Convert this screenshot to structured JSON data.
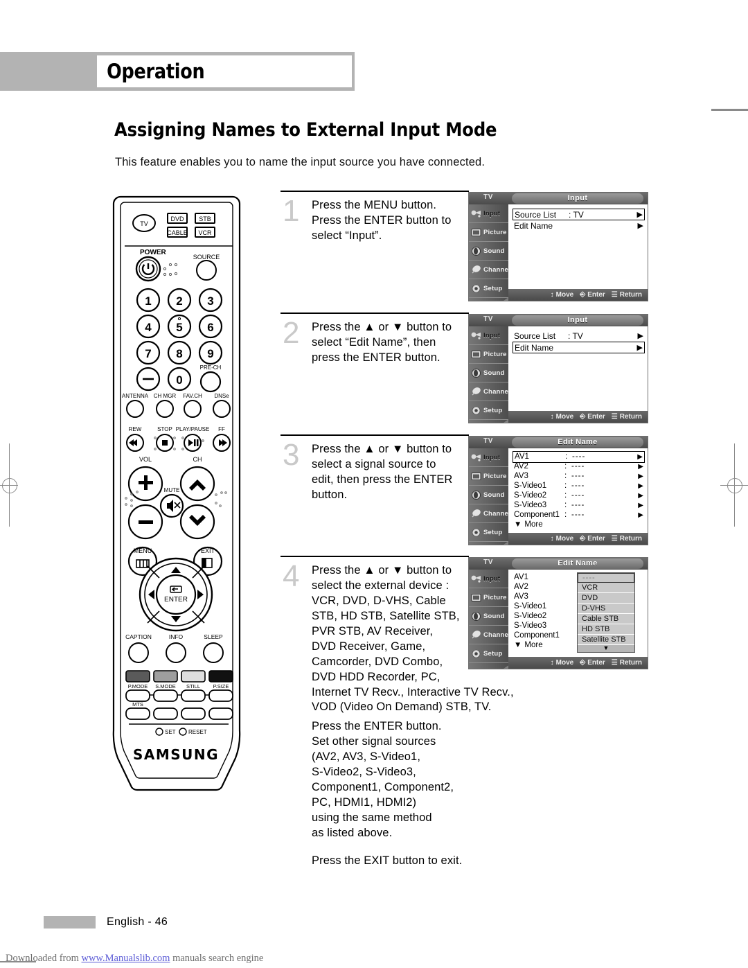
{
  "header": {
    "section_label": "Operation"
  },
  "page": {
    "title": "Assigning Names to External Input Mode",
    "intro": "This feature enables you to name the input source you have connected.",
    "footer_page": "English - 46",
    "download_prefix": "Downloaded from ",
    "download_link": "www.Manualslib.com",
    "download_suffix": " manuals search engine"
  },
  "steps": [
    {
      "num": "1",
      "lines": [
        "Press the MENU button.",
        "Press the ENTER button to",
        "select “Input”."
      ]
    },
    {
      "num": "2",
      "lines": [
        "Press the ▲ or ▼ button to",
        "select “Edit Name”, then",
        "press the ENTER button."
      ]
    },
    {
      "num": "3",
      "lines": [
        "Press the ▲ or ▼ button to",
        "select a signal source to",
        "edit, then press the ENTER",
        "button."
      ]
    },
    {
      "num": "4",
      "lines": [
        "Press the ▲ or ▼ button to",
        "select the external device :",
        "VCR, DVD, D-VHS, Cable",
        "STB, HD STB, Satellite STB,",
        "PVR STB, AV Receiver,",
        "DVD Receiver, Game,",
        "Camcorder, DVD Combo,",
        "DVD HDD Recorder, PC,",
        "Internet TV Recv., Interactive TV Recv.,",
        "VOD (Video On Demand) STB, TV."
      ]
    }
  ],
  "extra_block": {
    "lines": [
      "Press the ENTER button.",
      "Set other signal sources",
      "(AV2, AV3, S-Video1,",
      "S-Video2, S-Video3,",
      "Component1, Component2,",
      "PC, HDMI1, HDMI2)",
      "using the same method",
      "as listed above."
    ],
    "exit_line": "Press the EXIT button to exit."
  },
  "osd_common": {
    "tv_tag": "TV",
    "sidebar": [
      {
        "label": "Input",
        "icon": "input-icon"
      },
      {
        "label": "Picture",
        "icon": "picture-icon"
      },
      {
        "label": "Sound",
        "icon": "sound-icon"
      },
      {
        "label": "Channel",
        "icon": "channel-icon"
      },
      {
        "label": "Setup",
        "icon": "setup-icon"
      }
    ],
    "bottom": [
      {
        "label": "Move",
        "icon": "updown-arrow-icon"
      },
      {
        "label": "Enter",
        "icon": "enter-key-icon"
      },
      {
        "label": "Return",
        "icon": "return-key-icon"
      }
    ],
    "arrow_glyph": "▶",
    "more_label": "More",
    "more_glyph": "▼"
  },
  "osd1": {
    "title": "Input",
    "rows": [
      {
        "label": "Source List",
        "value": ": TV",
        "selected": true
      },
      {
        "label": "Edit Name",
        "value": "",
        "selected": false
      }
    ]
  },
  "osd2": {
    "title": "Input",
    "rows": [
      {
        "label": "Source List",
        "value": ": TV",
        "selected": false
      },
      {
        "label": "Edit Name",
        "value": "",
        "selected": true
      }
    ]
  },
  "osd3": {
    "title": "Edit Name",
    "entries": [
      {
        "name": "AV1",
        "colon": ":",
        "value": "----",
        "selected": true
      },
      {
        "name": "AV2",
        "colon": ":",
        "value": "----",
        "selected": false
      },
      {
        "name": "AV3",
        "colon": ":",
        "value": "----",
        "selected": false
      },
      {
        "name": "S-Video1",
        "colon": ":",
        "value": "----",
        "selected": false
      },
      {
        "name": "S-Video2",
        "colon": ":",
        "value": "----",
        "selected": false
      },
      {
        "name": "S-Video3",
        "colon": ":",
        "value": "----",
        "selected": false
      },
      {
        "name": "Component1",
        "colon": ":",
        "value": "----",
        "selected": false
      }
    ]
  },
  "osd4": {
    "title": "Edit Name",
    "entries": [
      {
        "name": "AV1"
      },
      {
        "name": "AV2"
      },
      {
        "name": "AV3"
      },
      {
        "name": "S-Video1"
      },
      {
        "name": "S-Video2"
      },
      {
        "name": "S-Video3"
      },
      {
        "name": "Component1"
      }
    ],
    "dropdown": [
      {
        "label": "----",
        "selected": true
      },
      {
        "label": "VCR",
        "selected": false
      },
      {
        "label": "DVD",
        "selected": false
      },
      {
        "label": "D-VHS",
        "selected": false
      },
      {
        "label": "Cable STB",
        "selected": false
      },
      {
        "label": "HD STB",
        "selected": false
      },
      {
        "label": "Satellite STB",
        "selected": false
      }
    ]
  },
  "remote": {
    "brand": "SAMSUNG",
    "mode_buttons": [
      "TV",
      "DVD",
      "STB",
      "CABLE",
      "VCR"
    ],
    "power_label": "POWER",
    "source_label": "SOURCE",
    "numbers": [
      "1",
      "2",
      "3",
      "4",
      "5",
      "6",
      "7",
      "8",
      "9",
      "—",
      "0"
    ],
    "prech_label": "PRE-CH",
    "func_row": [
      "ANTENNA",
      "CH MGR",
      "FAV.CH",
      "DNSe"
    ],
    "transport_row": [
      "REW",
      "STOP",
      "PLAY/PAUSE",
      "FF"
    ],
    "vol_label": "VOL",
    "ch_label": "CH",
    "mute_label": "MUTE",
    "menu_label": "MENU",
    "exit_label": "EXIT",
    "enter_label": "ENTER",
    "bottom_row": [
      "CAPTION",
      "INFO",
      "SLEEP"
    ],
    "color_row": [
      "P.MODE",
      "S.MODE",
      "STILL",
      "P.SIZE"
    ],
    "mts_label": "MTS",
    "set_label": "SET",
    "reset_label": "RESET"
  }
}
